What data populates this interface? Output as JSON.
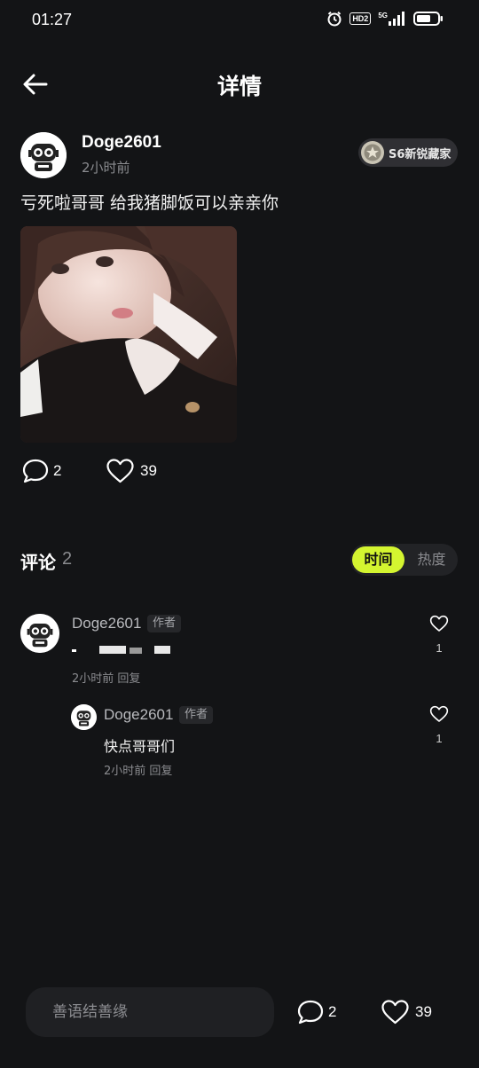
{
  "status_bar": {
    "time": "01:27",
    "hd_label": "HD2",
    "network_label": "5G"
  },
  "header": {
    "title": "详情",
    "back_icon": "arrow-left-icon"
  },
  "post": {
    "author": "Doge2601",
    "time": "2小时前",
    "badge_label": "S6新锐藏家",
    "content": "亏死啦哥哥 给我猪脚饭可以亲亲你",
    "comment_count": "2",
    "like_count": "39"
  },
  "comments_section": {
    "title": "评论",
    "count": "2",
    "sort_options": [
      "时间",
      "热度"
    ],
    "active_sort": "时间"
  },
  "comments": [
    {
      "author": "Doge2601",
      "tag": "作者",
      "text": "",
      "meta": "2小时前 回复",
      "likes": "1"
    }
  ],
  "replies": [
    {
      "author": "Doge2601",
      "tag": "作者",
      "text": "快点哥哥们",
      "meta": "2小时前 回复",
      "likes": "1"
    }
  ],
  "bottom_bar": {
    "input_placeholder": "善语结善缘",
    "comment_count": "2",
    "like_count": "39"
  },
  "colors": {
    "background": "#131416",
    "accent": "#d4f530",
    "secondary_text": "#8a8b8f"
  }
}
